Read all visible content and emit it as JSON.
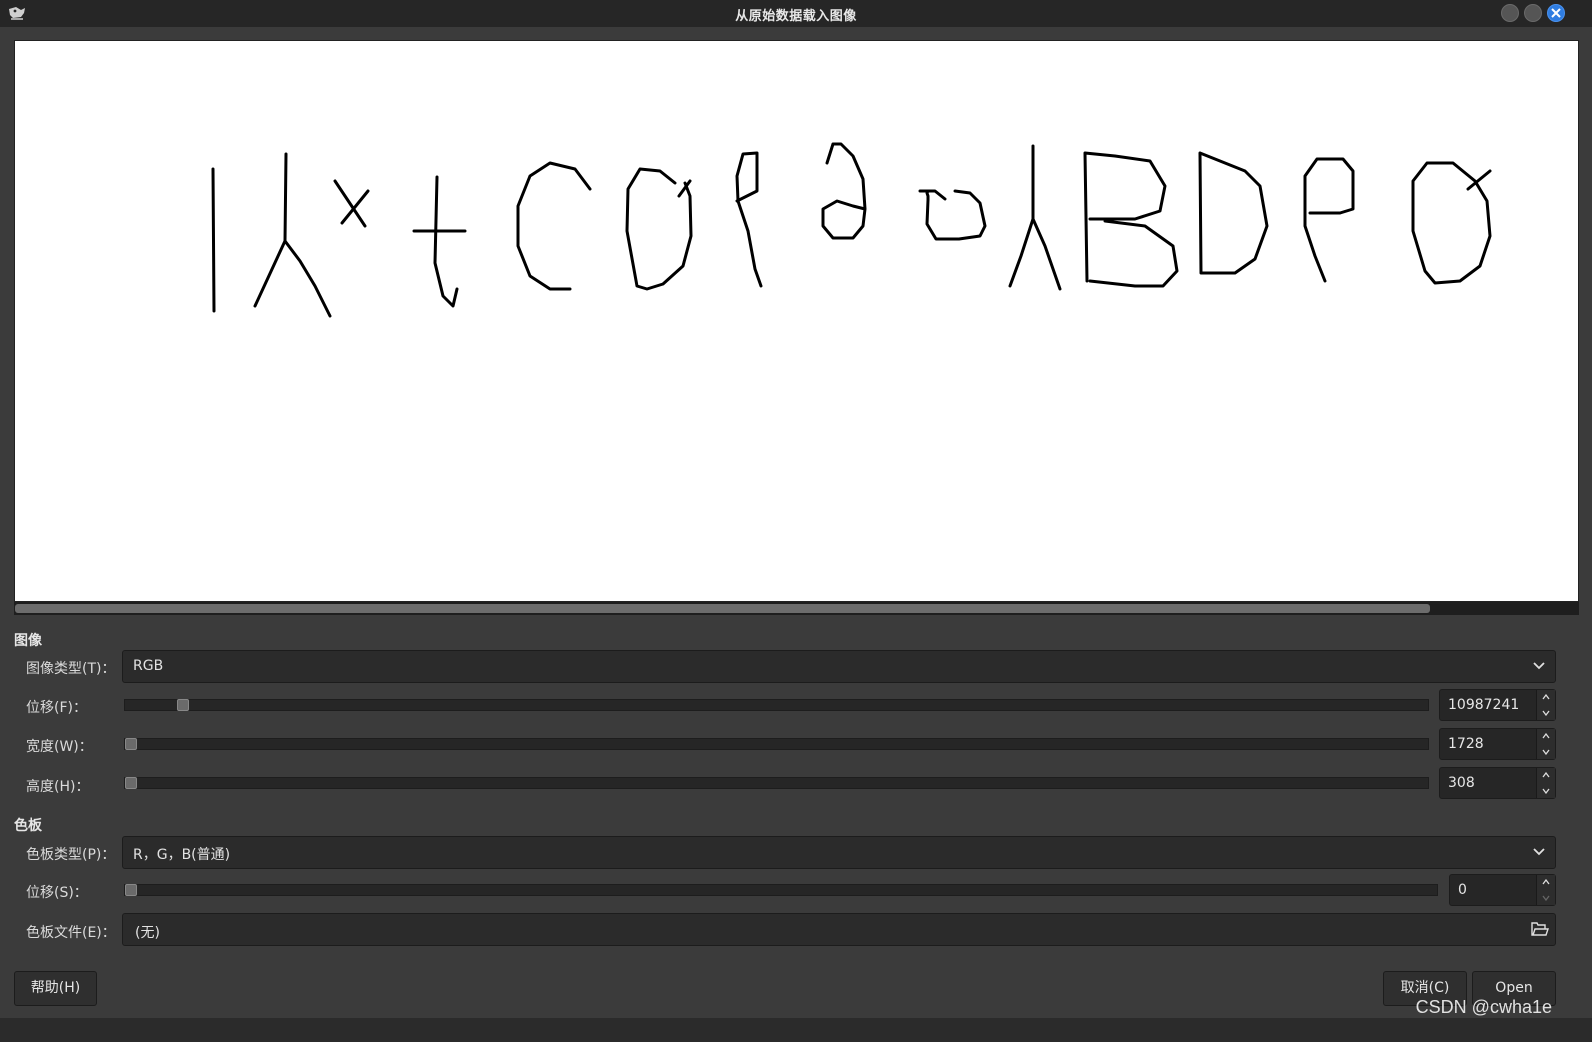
{
  "window": {
    "title": "从原始数据载入图像"
  },
  "preview": {
    "scroll_fraction": 0.905
  },
  "image_section": {
    "title": "图像",
    "image_type": {
      "label": "图像类型(T)：",
      "value": "RGB"
    },
    "offset": {
      "label": "位移(F)：",
      "value": "10987241",
      "slider_fraction": 0.04
    },
    "width": {
      "label": "宽度(W)：",
      "value": "1728",
      "slider_fraction": 0.0
    },
    "height": {
      "label": "高度(H)：",
      "value": "308",
      "slider_fraction": 0.0
    }
  },
  "palette_section": {
    "title": "色板",
    "palette_type": {
      "label": "色板类型(P)：",
      "value": "R，G，B(普通)"
    },
    "offset": {
      "label": "位移(S)：",
      "value": "0",
      "slider_fraction": 0.0
    },
    "palette_file": {
      "label": "色板文件(E)：",
      "value": "(无)"
    }
  },
  "buttons": {
    "help": "帮助(H)",
    "cancel": "取消(C)",
    "open": "Open"
  },
  "watermark": "CSDN @cwha1e",
  "colors": {
    "accent_close": "#2f7de1",
    "panel_bg": "#3b3b3b",
    "field_bg": "#2b2b2b"
  }
}
